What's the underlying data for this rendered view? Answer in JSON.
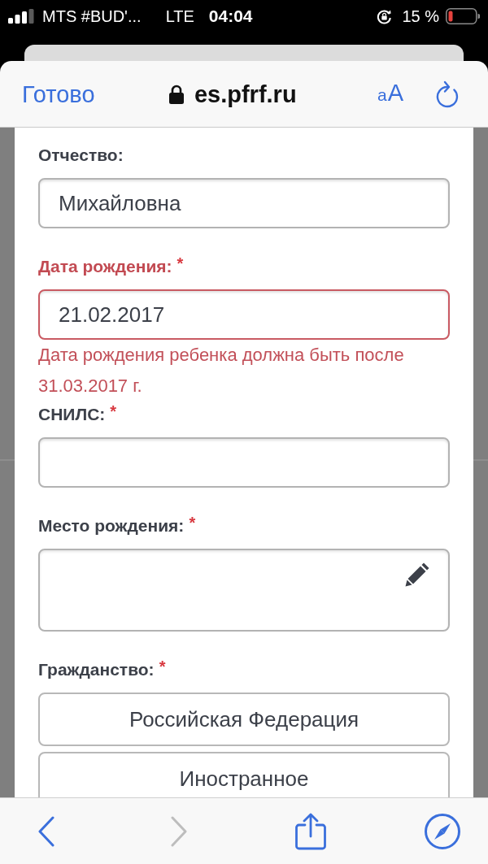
{
  "status_bar": {
    "carrier": "MTS #BUD'...",
    "network": "LTE",
    "time": "04:04",
    "battery": "15 %"
  },
  "browser_header": {
    "done_button": "Готово",
    "url": "es.pfrf.ru",
    "reader_button": {
      "small_letter": "a",
      "large_letter": "A"
    }
  },
  "form": {
    "fields": [
      {
        "kind": "text",
        "label": "Отчество:",
        "value": "Михайловна",
        "error": false
      },
      {
        "kind": "text",
        "label": "Дата рождения:",
        "required_mark": "*",
        "value": "21.02.2017",
        "error": true,
        "error_message": "Дата рождения ребенка должна быть после 31.03.2017 г."
      },
      {
        "kind": "text",
        "label": "СНИЛС:",
        "required_mark": "*",
        "error": false
      },
      {
        "kind": "textarea",
        "label": "Место рождения:",
        "required_mark": "*",
        "error": false
      },
      {
        "kind": "choice",
        "label": "Гражданство:",
        "required_mark": "*",
        "error": false,
        "options": [
          {
            "label": "Российская Федерация",
            "selected": false
          },
          {
            "label": "Иностранное",
            "selected": false
          }
        ]
      }
    ]
  },
  "toolbar": [
    {
      "kind": "back",
      "disabled": false
    },
    {
      "kind": "forward",
      "disabled": true
    },
    {
      "kind": "share",
      "disabled": false
    },
    {
      "kind": "compass",
      "disabled": false
    }
  ]
}
